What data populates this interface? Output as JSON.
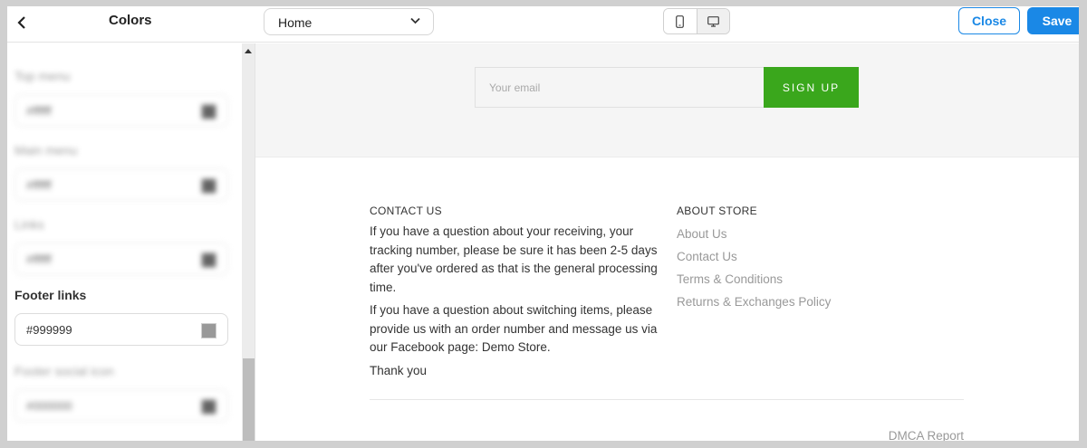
{
  "topbar": {
    "panel_title": "Colors",
    "page_select": "Home",
    "close_label": "Close",
    "save_label": "Save",
    "accent_color": "#1a88e6"
  },
  "sidebar": {
    "fields": [
      {
        "label": "Top menu",
        "value": "#ffffff",
        "swatch": "#222222"
      },
      {
        "label": "Main menu",
        "value": "#ffffff",
        "swatch": "#222222"
      },
      {
        "label": "Links",
        "value": "#ffffff",
        "swatch": "#222222"
      },
      {
        "label": "Footer links",
        "value": "#999999",
        "swatch": "#999999"
      },
      {
        "label": "Footer social icon",
        "value": "#000000",
        "swatch": "#222222"
      }
    ]
  },
  "preview": {
    "email_placeholder": "Your email",
    "signup_label": "SIGN UP",
    "signup_color": "#3aa71c",
    "contact": {
      "heading": "CONTACT US",
      "paragraphs": [
        "If you have a question about your receiving, your tracking number, please be sure it has been 2-5 days after you've ordered as that is the general processing time.",
        "If you have a question about switching items, please provide us with an order number and message us via our Facebook page: Demo Store.",
        "Thank you"
      ]
    },
    "about": {
      "heading": "ABOUT STORE",
      "links": [
        "About Us",
        "Contact Us",
        "Terms & Conditions",
        "Returns & Exchanges Policy"
      ]
    },
    "dmca": "DMCA Report"
  }
}
